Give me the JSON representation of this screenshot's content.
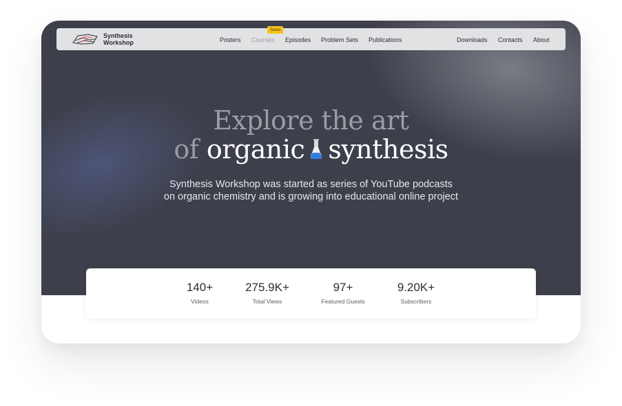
{
  "brand": {
    "line1": "Synthesis",
    "line2": "Workshop"
  },
  "nav": {
    "posters": "Posters",
    "courses": "Courses",
    "courses_badge": "Soon",
    "episodes": "Episodes",
    "problem_sets": "Problem Sets",
    "publications": "Publications",
    "downloads": "Downloads",
    "contacts": "Contacts",
    "about": "About"
  },
  "hero": {
    "line1": "Explore the art",
    "line2_prefix": "of",
    "line2_word1": "organic",
    "line2_word2": "synthesis",
    "subtitle_line1": "Synthesis Workshop was started as series of YouTube podcasts",
    "subtitle_line2": "on organic chemistry and is growing into educational online project"
  },
  "stats": [
    {
      "value": "140+",
      "label": "Videos"
    },
    {
      "value": "275.9K+",
      "label": "Total Views"
    },
    {
      "value": "97+",
      "label": "Featured Guests"
    },
    {
      "value": "9.20K+",
      "label": "Subscribers"
    }
  ],
  "colors": {
    "hero_bg": "#3d3f4a",
    "badge": "#f4c21a",
    "flask": "#2f7de0"
  },
  "icons": {
    "logo": "synthesis-logo-icon",
    "hero": "flask-icon"
  }
}
